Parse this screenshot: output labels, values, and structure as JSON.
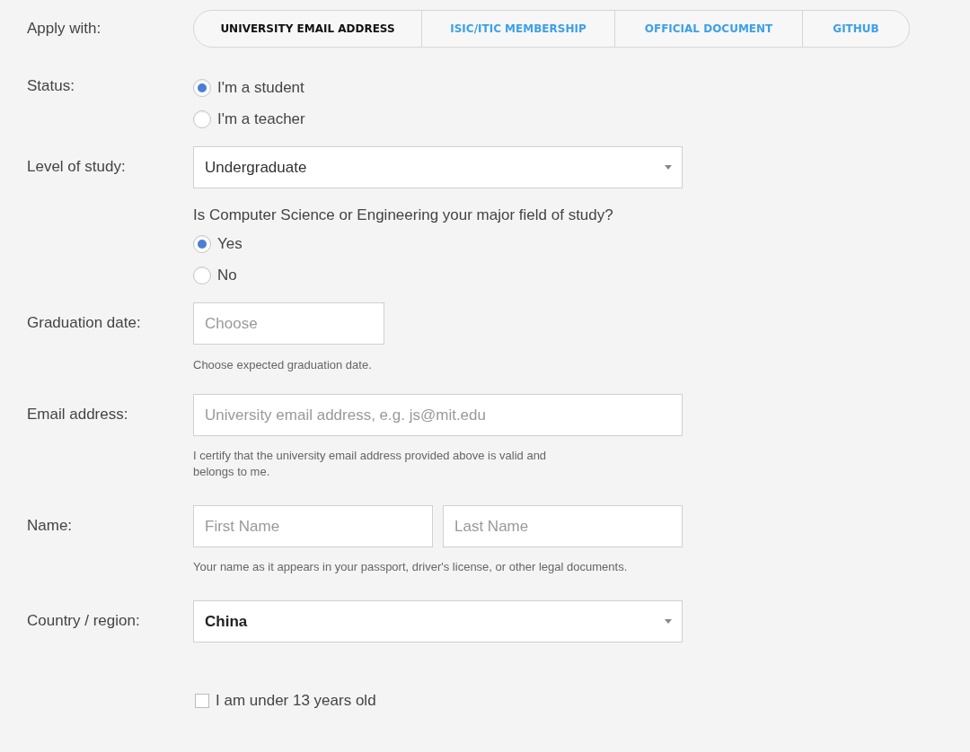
{
  "apply_with": {
    "label": "Apply with:",
    "tabs": [
      {
        "label": "UNIVERSITY EMAIL ADDRESS",
        "selected": true
      },
      {
        "label": "ISIC/ITIC MEMBERSHIP",
        "selected": false
      },
      {
        "label": "OFFICIAL DOCUMENT",
        "selected": false
      },
      {
        "label": "GITHUB",
        "selected": false
      }
    ]
  },
  "status": {
    "label": "Status:",
    "options": [
      {
        "label": "I'm a student",
        "selected": true
      },
      {
        "label": "I'm a teacher",
        "selected": false
      }
    ]
  },
  "level_of_study": {
    "label": "Level of study:",
    "value": "Undergraduate"
  },
  "major_question": {
    "text": "Is Computer Science or Engineering your major field of study?",
    "options": [
      {
        "label": "Yes",
        "selected": true
      },
      {
        "label": "No",
        "selected": false
      }
    ]
  },
  "graduation_date": {
    "label": "Graduation date:",
    "placeholder": "Choose",
    "hint": "Choose expected graduation date."
  },
  "email": {
    "label": "Email address:",
    "placeholder": "University email address, e.g. js@mit.edu",
    "hint": "I certify that the university email address provided above is valid and belongs to me."
  },
  "name": {
    "label": "Name:",
    "first_placeholder": "First Name",
    "last_placeholder": "Last Name",
    "hint": "Your name as it appears in your passport, driver's license, or other legal documents."
  },
  "country": {
    "label": "Country / region:",
    "value": "China"
  },
  "age_checkbox": {
    "label": "I am under 13 years old",
    "checked": false
  }
}
